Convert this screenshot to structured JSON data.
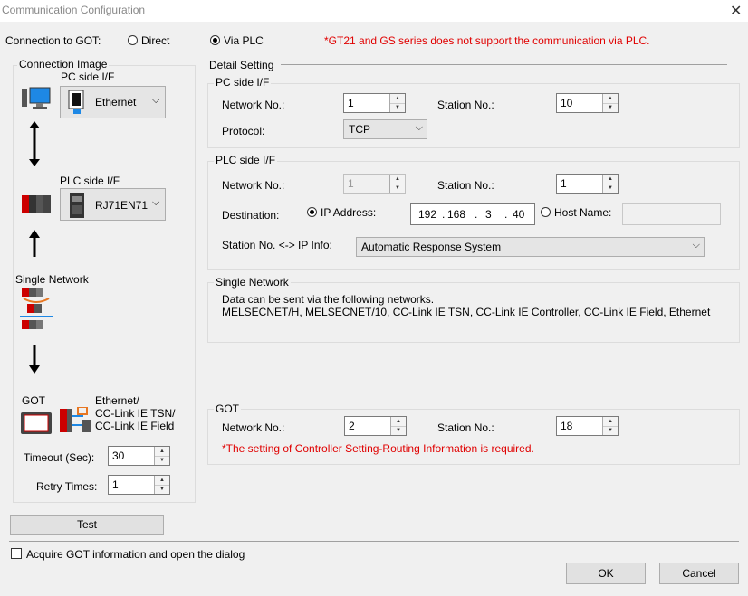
{
  "window": {
    "title": "Communication Configuration"
  },
  "connection": {
    "label": "Connection to GOT:",
    "direct": "Direct",
    "via_plc": "Via PLC",
    "note": "*GT21 and GS series does not support the communication via PLC."
  },
  "image": {
    "title": "Connection Image",
    "pc_side_label": "PC side I/F",
    "pc_side_value": "Ethernet",
    "plc_side_label": "PLC side I/F",
    "plc_side_value": "RJ71EN71",
    "single_network": "Single Network",
    "got": "GOT",
    "got_desc": [
      "Ethernet/",
      "CC-Link IE TSN/",
      "CC-Link IE Field"
    ],
    "timeout_label": "Timeout (Sec):",
    "timeout_value": "30",
    "retry_label": "Retry Times:",
    "retry_value": "1"
  },
  "detail": {
    "title": "Detail Setting",
    "pc_if": {
      "title": "PC side I/F",
      "network_label": "Network No.:",
      "network_value": "1",
      "station_label": "Station No.:",
      "station_value": "10",
      "protocol_label": "Protocol:",
      "protocol_value": "TCP"
    },
    "plc_if": {
      "title": "PLC side I/F",
      "network_label": "Network No.:",
      "network_value": "1",
      "station_label": "Station No.:",
      "station_value": "1",
      "dest_label": "Destination:",
      "ip_label": "IP Address:",
      "ip": [
        "192",
        "168",
        "3",
        "40"
      ],
      "host_label": "Host Name:",
      "host_value": "",
      "info_label": "Station No. <-> IP Info:",
      "info_value": "Automatic Response System"
    },
    "single": {
      "title": "Single Network",
      "line1": "Data can be sent via the following networks.",
      "line2": "MELSECNET/H, MELSECNET/10, CC-Link IE TSN, CC-Link IE Controller, CC-Link IE Field, Ethernet"
    },
    "got": {
      "title": "GOT",
      "network_label": "Network No.:",
      "network_value": "2",
      "station_label": "Station No.:",
      "station_value": "18",
      "note": "*The setting of Controller Setting-Routing Information is required."
    }
  },
  "buttons": {
    "test": "Test",
    "ok": "OK",
    "cancel": "Cancel"
  },
  "acquire_label": "Acquire GOT information and open the dialog"
}
